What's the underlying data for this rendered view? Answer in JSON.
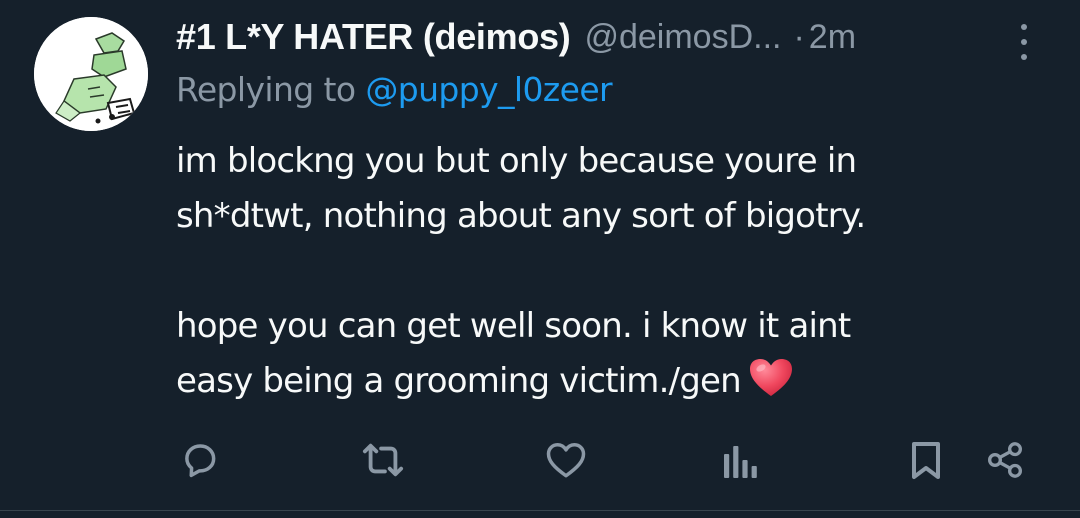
{
  "tweet": {
    "display_name": "#1 L*Y HATER (deimos)",
    "handle": "@deimosD...",
    "separator": "·",
    "time": "2m",
    "reply_prefix": "Replying to ",
    "reply_mention": "@puppy_l0zeer",
    "text_lines": [
      "im blockng you but only because youre in",
      "sh*dtwt, nothing about any sort of bigotry.",
      "hope you can get well soon. i know it aint",
      "easy being a grooming victim./gen"
    ],
    "emoji": "red-heart"
  },
  "icons": {
    "more": "more-vertical-icon",
    "reply": "reply-icon",
    "retweet": "retweet-icon",
    "like": "heart-icon",
    "views": "views-icon",
    "bookmark": "bookmark-icon",
    "share": "share-icon"
  },
  "colors": {
    "background": "#15202b",
    "text": "#f7f9f9",
    "secondary": "#8b98a5",
    "link": "#1d9bf0",
    "heart_emoji": "#f0475e"
  }
}
